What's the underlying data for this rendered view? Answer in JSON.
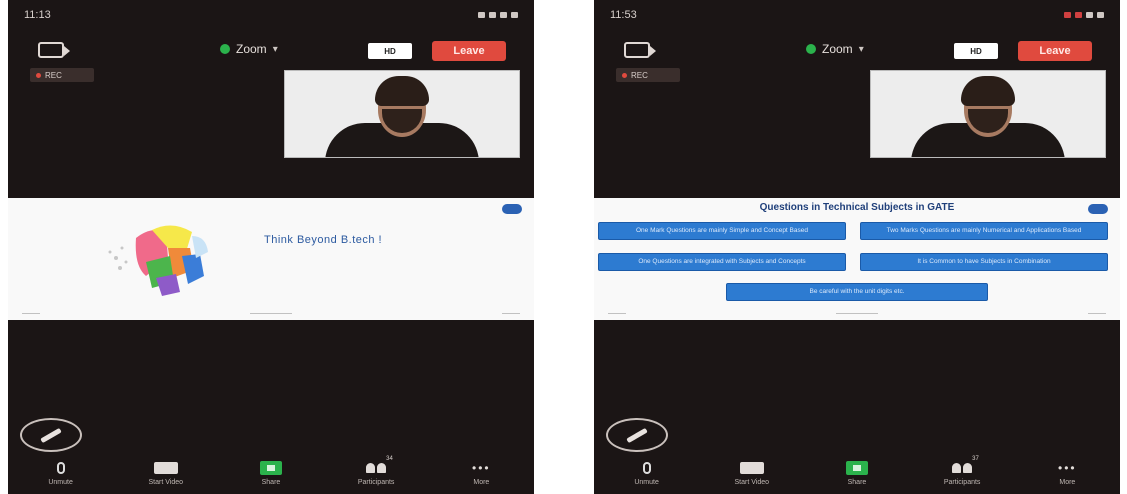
{
  "left": {
    "status_time": "11:13",
    "meeting_title": "Zoom",
    "hd_label": "HD",
    "leave_label": "Leave",
    "rec_label": "REC",
    "slide_title": "Think Beyond B.tech !",
    "toolbar": {
      "mute": "Unmute",
      "video": "Start Video",
      "share": "Share",
      "participants": "Participants",
      "participants_count": "34",
      "more": "More"
    }
  },
  "right": {
    "status_time": "11:53",
    "meeting_title": "Zoom",
    "hd_label": "HD",
    "leave_label": "Leave",
    "rec_label": "REC",
    "slide_title": "Questions in Technical Subjects in GATE",
    "topics": [
      "One Mark Questions are mainly Simple and Concept Based",
      "Two Marks Questions are mainly Numerical and Applications Based",
      "One Questions are integrated with Subjects and Concepts",
      "It is Common to have Subjects in Combination",
      "Be careful with the unit digits etc."
    ],
    "toolbar": {
      "mute": "Unmute",
      "video": "Start Video",
      "share": "Share",
      "participants": "Participants",
      "participants_count": "37",
      "more": "More"
    }
  },
  "colors": {
    "leave": "#e04a3e",
    "share": "#2bb24c",
    "topic_button": "#2d7bd1"
  }
}
